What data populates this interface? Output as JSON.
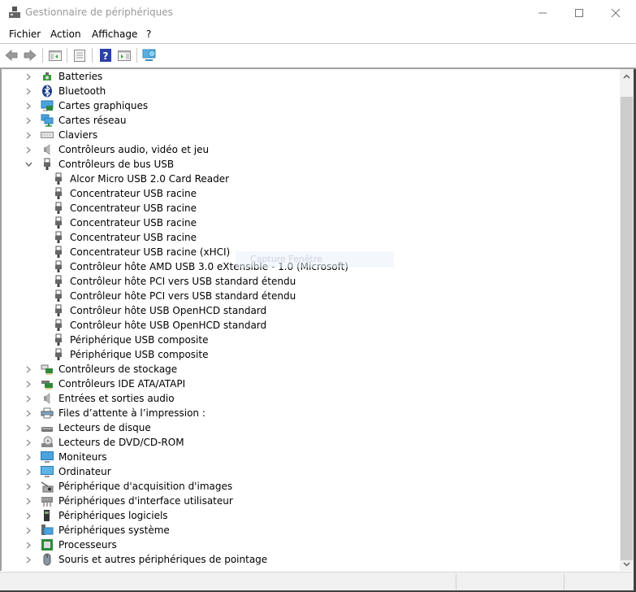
{
  "window": {
    "title": "Gestionnaire de périphériques",
    "icon": "device-manager-icon",
    "controls": {
      "minimize": "minimize-icon",
      "maximize": "maximize-icon",
      "close": "close-icon"
    }
  },
  "menubar": {
    "items": [
      "Fichier",
      "Action",
      "Affichage",
      "?"
    ]
  },
  "toolbar": {
    "buttons": [
      {
        "name": "back",
        "icon": "arrow-left-icon"
      },
      {
        "name": "forward",
        "icon": "arrow-right-icon"
      },
      {
        "name": "show-hide-console-tree",
        "icon": "console-tree-icon"
      },
      {
        "name": "properties",
        "icon": "properties-icon"
      },
      {
        "name": "help",
        "icon": "help-icon"
      },
      {
        "name": "show-action-pane",
        "icon": "action-pane-icon"
      },
      {
        "name": "scan-hardware",
        "icon": "monitor-scan-icon"
      }
    ]
  },
  "tree": {
    "categories": [
      {
        "label": "Batteries",
        "icon": "battery-icon",
        "expanded": false
      },
      {
        "label": "Bluetooth",
        "icon": "bluetooth-icon",
        "expanded": false
      },
      {
        "label": "Cartes graphiques",
        "icon": "display-adapter-icon",
        "expanded": false
      },
      {
        "label": "Cartes réseau",
        "icon": "network-adapter-icon",
        "expanded": false
      },
      {
        "label": "Claviers",
        "icon": "keyboard-icon",
        "expanded": false
      },
      {
        "label": "Contrôleurs audio, vidéo et jeu",
        "icon": "speaker-icon",
        "expanded": false
      },
      {
        "label": "Contrôleurs de bus USB",
        "icon": "usb-icon",
        "expanded": true,
        "children": [
          "Alcor Micro USB 2.0 Card Reader",
          "Concentrateur USB racine",
          "Concentrateur USB racine",
          "Concentrateur USB racine",
          "Concentrateur USB racine",
          "Concentrateur USB racine (xHCI)",
          "Contrôleur hôte AMD USB 3.0 eXtensible - 1.0 (Microsoft)",
          "Contrôleur hôte PCI vers USB standard étendu",
          "Contrôleur hôte PCI vers USB standard étendu",
          "Contrôleur hôte USB OpenHCD standard",
          "Contrôleur hôte USB OpenHCD standard",
          "Périphérique USB composite",
          "Périphérique USB composite"
        ]
      },
      {
        "label": "Contrôleurs de stockage",
        "icon": "storage-controller-icon",
        "expanded": false
      },
      {
        "label": "Contrôleurs IDE ATA/ATAPI",
        "icon": "ide-controller-icon",
        "expanded": false
      },
      {
        "label": "Entrées et sorties audio",
        "icon": "speaker-icon",
        "expanded": false
      },
      {
        "label": "Files d’attente à l’impression :",
        "icon": "printer-icon",
        "expanded": false
      },
      {
        "label": "Lecteurs de disque",
        "icon": "disk-drive-icon",
        "expanded": false
      },
      {
        "label": "Lecteurs de DVD/CD-ROM",
        "icon": "dvd-drive-icon",
        "expanded": false
      },
      {
        "label": "Moniteurs",
        "icon": "monitor-icon",
        "expanded": false
      },
      {
        "label": "Ordinateur",
        "icon": "computer-icon",
        "expanded": false
      },
      {
        "label": "Périphérique d'acquisition d'images",
        "icon": "camera-icon",
        "expanded": false
      },
      {
        "label": "Périphériques d'interface utilisateur",
        "icon": "hid-icon",
        "expanded": false
      },
      {
        "label": "Périphériques logiciels",
        "icon": "software-device-icon",
        "expanded": false
      },
      {
        "label": "Périphériques système",
        "icon": "system-device-icon",
        "expanded": false
      },
      {
        "label": "Processeurs",
        "icon": "processor-icon",
        "expanded": false
      },
      {
        "label": "Souris et autres périphériques de pointage",
        "icon": "mouse-icon",
        "expanded": false
      }
    ]
  },
  "overlay": {
    "ghost_text": "Capture Fenêtre"
  },
  "colors": {
    "title_text": "#999999",
    "border_dark": "#404040",
    "scroll_thumb": "#cdcdcd",
    "status_bg": "#f0f0f0"
  }
}
